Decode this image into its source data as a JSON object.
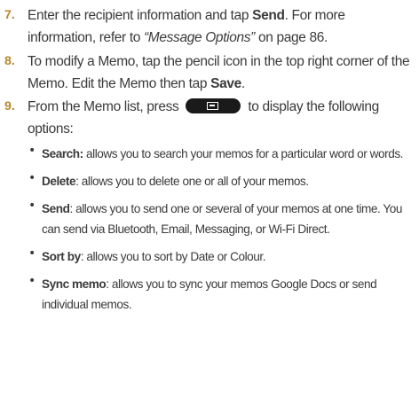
{
  "steps": [
    {
      "number": "7.",
      "text_before": "Enter the recipient information and tap ",
      "bold": "Send",
      "text_mid": ". For more information, refer to ",
      "italic": "“Message Options”",
      "text_after": "  on page 86."
    },
    {
      "number": "8.",
      "text_before": "To modify a Memo, tap the pencil icon in the top right corner of the Memo. Edit the Memo then tap ",
      "bold": "Save",
      "text_after": "."
    },
    {
      "number": "9.",
      "text_before": "From the Memo list, press ",
      "key_icon": "menu-key-icon",
      "text_after": " to display the following options:"
    }
  ],
  "options": [
    {
      "term": "Search:",
      "desc": " allows you to search your memos for a particular word or words."
    },
    {
      "term": "Delete",
      "desc": ": allows you to delete one or all of your memos."
    },
    {
      "term": "Send",
      "desc": ": allows you to send one or several of your memos at one time. You can send via Bluetooth, Email, Messaging, or Wi-Fi Direct."
    },
    {
      "term": "Sort by",
      "desc": ": allows you to sort by Date or Colour."
    },
    {
      "term": "Sync memo",
      "desc": ": allows you to sync your memos Google Docs or send individual memos."
    }
  ],
  "colors": {
    "step_number": "#b8862a",
    "body_text": "#3a3a3a",
    "key_bg": "#1a1a1a"
  }
}
